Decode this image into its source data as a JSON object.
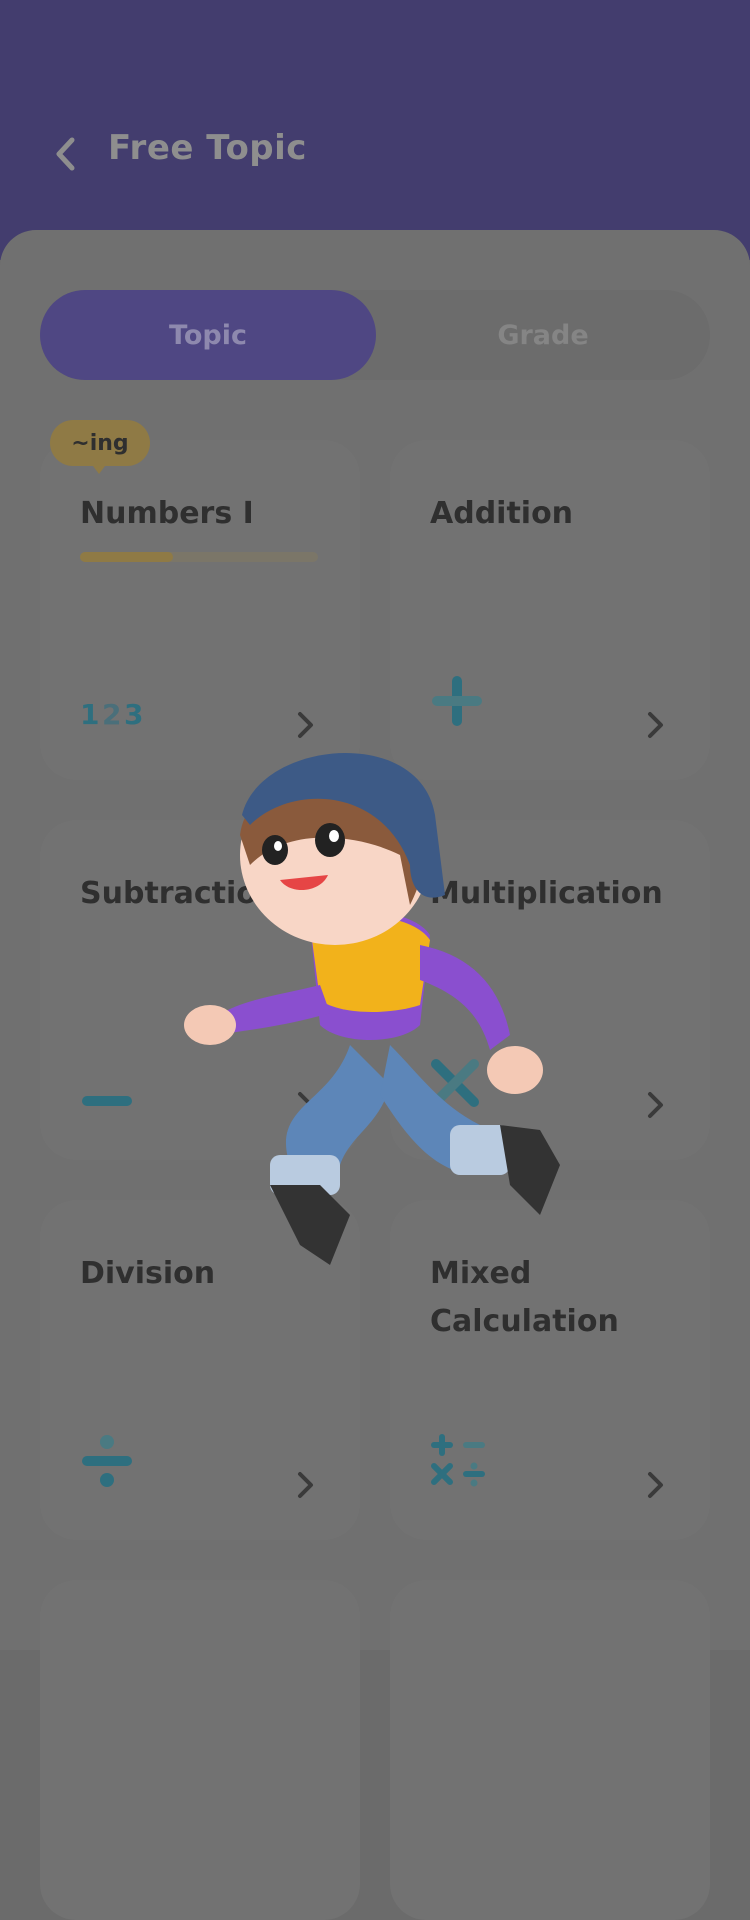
{
  "header": {
    "title": "Free Topic"
  },
  "tabs": {
    "topic": "Topic",
    "grade": "Grade"
  },
  "badge": "~ing",
  "cards": [
    {
      "title": "Numbers I",
      "icon": "numbers-123-icon",
      "progress": 0.39
    },
    {
      "title": "Addition",
      "icon": "plus-icon"
    },
    {
      "title": "Subtraction",
      "icon": "minus-icon"
    },
    {
      "title": "Multiplication",
      "icon": "times-icon"
    },
    {
      "title": "Division",
      "icon": "divide-icon"
    },
    {
      "title": "Mixed\nCalculation",
      "icon": "mixed-operations-icon"
    }
  ],
  "colors": {
    "header": "#433d6e",
    "accent": "#4f4783",
    "badge": "#8f7a45",
    "icon": "#2e6f7f"
  }
}
